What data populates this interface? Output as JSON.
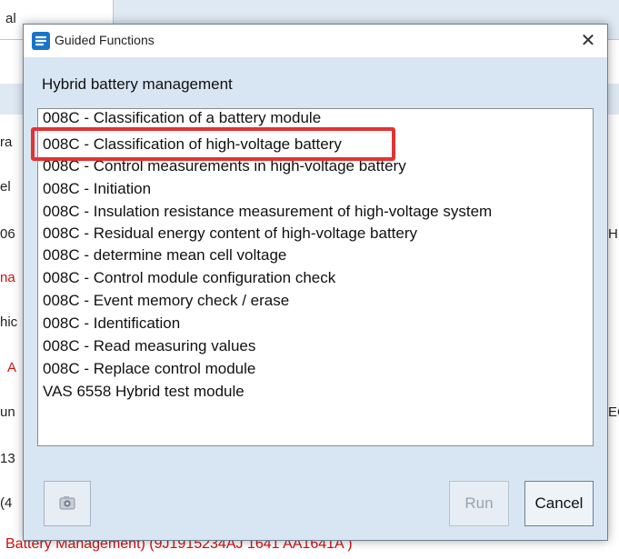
{
  "background": {
    "tab_label": "al",
    "left_fragments": [
      {
        "text": "ra",
        "red": false
      },
      {
        "text": "el",
        "red": false
      },
      {
        "text": "06",
        "red": false
      },
      {
        "text": "na",
        "red": true
      },
      {
        "text": "hic",
        "red": false
      },
      {
        "text": "A",
        "red": true
      },
      {
        "text": "un",
        "red": false
      },
      {
        "text": "13",
        "red": false
      },
      {
        "text": "(4",
        "red": false
      }
    ],
    "right_fragments": [
      "H",
      "EC"
    ],
    "bottom_text": "Battery Management) (9J1915234AJ   1641   AA1641A     )"
  },
  "dialog": {
    "title": "Guided Functions",
    "close_glyph": "✕",
    "heading": "Hybrid battery management",
    "items": [
      "008C  - Classification of a battery module",
      "008C  - Classification of high-voltage battery",
      "008C  - Control measurements in high-voltage battery",
      "008C  - Initiation",
      "008C  - Insulation resistance measurement of high-voltage system",
      "008C  - Residual energy content of high-voltage battery",
      "008C  - determine mean cell voltage",
      "008C - Control module configuration check",
      "008C - Event memory check / erase",
      "008C - Identification",
      "008C - Read measuring values",
      "008C - Replace control module",
      "VAS 6558 Hybrid test module"
    ],
    "highlighted_index": 1,
    "buttons": {
      "camera_icon": "camera-icon",
      "run": "Run",
      "cancel": "Cancel"
    },
    "colors": {
      "dialog_bg": "#d8e6f3",
      "highlight": "#e03434",
      "accent_red": "#d01010"
    }
  }
}
